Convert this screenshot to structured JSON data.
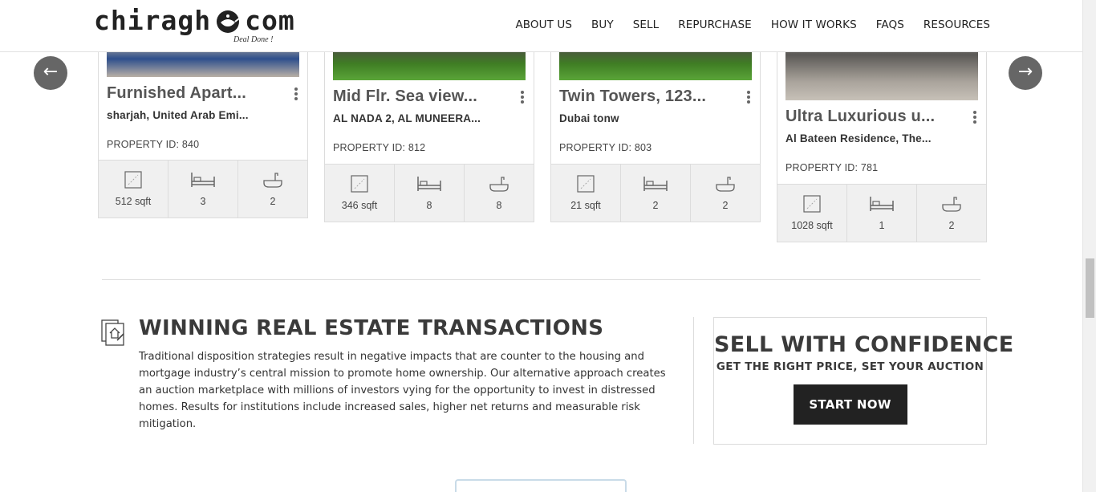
{
  "brand": {
    "name_left": "chiragh",
    "name_right": "com",
    "tagline": "Deal Done !"
  },
  "nav": {
    "items": [
      "ABOUT US",
      "BUY",
      "SELL",
      "REPURCHASE",
      "HOW IT WORKS",
      "FAQS",
      "RESOURCES"
    ]
  },
  "carousel": {
    "prev_symbol": "←",
    "next_symbol": "→",
    "cards": [
      {
        "title": "Furnished Apart...",
        "location": "sharjah, United Arab Emi...",
        "property_id": "PROPERTY ID: 840",
        "area": "512 sqft",
        "beds": "3",
        "baths": "2"
      },
      {
        "title": "Mid Flr. Sea view...",
        "location": "AL NADA 2, AL MUNEERA...",
        "property_id": "PROPERTY ID: 812",
        "area": "346 sqft",
        "beds": "8",
        "baths": "8"
      },
      {
        "title": "Twin Towers, 123...",
        "location": "Dubai tonw",
        "property_id": "PROPERTY ID: 803",
        "area": "21 sqft",
        "beds": "2",
        "baths": "2"
      },
      {
        "title": "Ultra Luxurious u...",
        "location": "Al Bateen Residence, The...",
        "property_id": "PROPERTY ID: 781",
        "area": "1028 sqft",
        "beds": "1",
        "baths": "2"
      }
    ]
  },
  "winning": {
    "title": "WINNING REAL ESTATE TRANSACTIONS",
    "text": "Traditional disposition strategies result in negative impacts that are counter to the housing and mortgage industry’s central mission to promote home ownership. Our alternative approach creates an auction marketplace with millions of investors vying for the opportunity to invest in distressed homes. Results for institutions include increased sales, higher net returns and measurable risk mitigation."
  },
  "sell": {
    "title": "SELL WITH CONFIDENCE",
    "subtitle": "GET THE RIGHT PRICE, SET YOUR AUCTION",
    "button": "START NOW"
  },
  "icons": {
    "lamp": "genie-lamp-icon",
    "more": "kebab-menu-icon",
    "area": "area-icon",
    "bed": "bed-icon",
    "bath": "bathtub-icon",
    "section": "property-document-icon"
  },
  "colors": {
    "arrow_bg": "#666666",
    "button_bg": "#222222",
    "stats_bg": "#f0f0f0"
  }
}
